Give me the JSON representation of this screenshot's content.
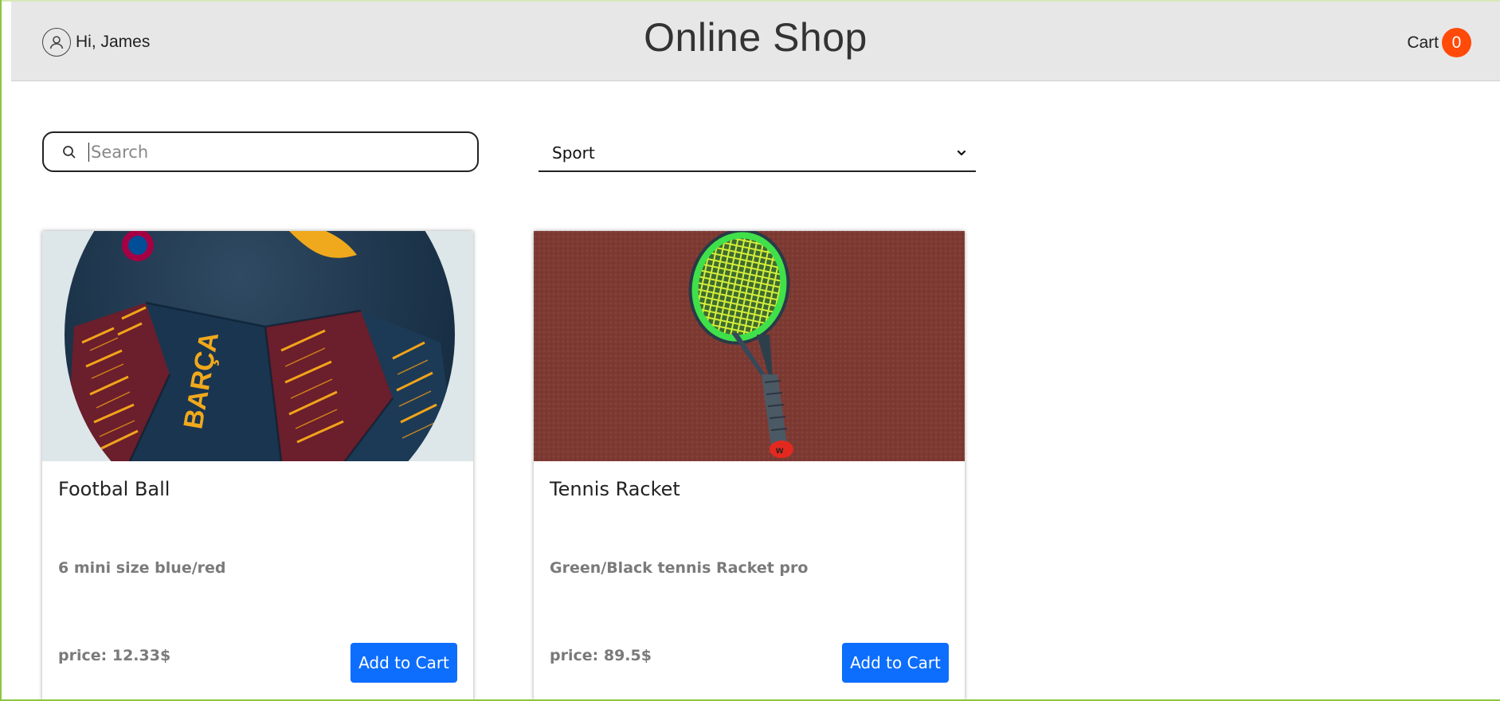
{
  "header": {
    "title": "Online Shop",
    "greeting": "Hi, James",
    "user_icon": "user-circle-icon",
    "cart_label": "Cart",
    "cart_count": "0",
    "cart_badge_color": "#ff4a0a"
  },
  "search": {
    "placeholder": "Search",
    "value": "",
    "icon": "search-icon"
  },
  "category": {
    "selected": "Sport",
    "icon": "chevron-down-icon"
  },
  "products": [
    {
      "name": "Footbal Ball",
      "description": "6 mini size blue/red",
      "price": "price: 12.33$",
      "button_label": "Add to Cart",
      "image": "football-ball-image"
    },
    {
      "name": "Tennis Racket",
      "description": "Green/Black tennis Racket pro",
      "price": "price: 89.5$",
      "button_label": "Add to Cart",
      "image": "tennis-racket-image"
    }
  ],
  "colors": {
    "header_bg": "#e7e7e7",
    "accent_button": "#0d6efd"
  }
}
